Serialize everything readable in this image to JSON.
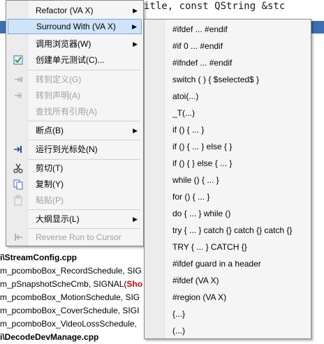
{
  "editor": {
    "code_top": "itle,   const QString &stc",
    "bottom_lines": [
      {
        "text": "i\\StreamConfig.cpp",
        "bold": true,
        "red": ""
      },
      {
        "text": "m_pcomboBox_RecordSchedule, SIG",
        "bold": false,
        "red": ""
      },
      {
        "text": "m_pSnapshotScheCmb, SIGNAL(",
        "bold": false,
        "red": "Sho"
      },
      {
        "text": "m_pcomboBox_MotionSchedule, SIG",
        "bold": false,
        "red": ""
      },
      {
        "text": "m_pcomboBox_CoverSchedule, SIGI",
        "bold": false,
        "red": ""
      },
      {
        "text": "m_pcomboBox_VideoLossSchedule,",
        "bold": false,
        "red": ""
      },
      {
        "text": "i\\DecodeDevManage.cpp",
        "bold": true,
        "red": ""
      }
    ]
  },
  "context_menu": {
    "items": [
      {
        "label": "Refactor (VA X)",
        "submenu": true,
        "disabled": false,
        "icon": ""
      },
      {
        "label": "Surround With (VA X)",
        "submenu": true,
        "disabled": false,
        "highlight": true,
        "icon": ""
      },
      {
        "label": "调用浏览器(W)",
        "submenu": true,
        "disabled": false,
        "icon": ""
      },
      {
        "label": "创建单元测试(C)...",
        "submenu": false,
        "disabled": false,
        "icon": "unit-test-icon"
      },
      {
        "label": "转到定义(G)",
        "submenu": false,
        "disabled": true,
        "icon": "goto-definition-icon"
      },
      {
        "label": "转到声明(A)",
        "submenu": false,
        "disabled": true,
        "icon": "goto-declaration-icon"
      },
      {
        "label": "查找所有引用(A)",
        "submenu": false,
        "disabled": true,
        "icon": ""
      },
      {
        "label": "断点(B)",
        "submenu": true,
        "disabled": false,
        "icon": ""
      },
      {
        "label": "运行到光标处(N)",
        "submenu": false,
        "disabled": false,
        "icon": "run-to-cursor-icon"
      },
      {
        "label": "剪切(T)",
        "submenu": false,
        "disabled": false,
        "icon": "cut-icon"
      },
      {
        "label": "复制(Y)",
        "submenu": false,
        "disabled": false,
        "icon": "copy-icon"
      },
      {
        "label": "粘贴(P)",
        "submenu": false,
        "disabled": true,
        "icon": "paste-icon"
      },
      {
        "label": "大纲显示(L)",
        "submenu": true,
        "disabled": false,
        "icon": ""
      },
      {
        "label": "Reverse Run to Cursor",
        "submenu": false,
        "disabled": true,
        "icon": "reverse-run-icon"
      }
    ]
  },
  "surround_submenu": {
    "items": [
      "#ifdef ... #endif",
      "#if 0 ... #endif",
      "#ifndef ... #endif",
      "switch ( ) { $selected$ }",
      "atoi(...)",
      "_T(...)",
      "if () { ... }",
      "if () { ... } else { }",
      "if () { } else { ... }",
      "while () { ... }",
      "for () { ... }",
      "do { ... } while ()",
      "try { ... } catch {} catch {} catch {}",
      "TRY { ... } CATCH {}",
      "#ifdef guard in a header",
      "#ifdef (VA X)",
      "#region (VA X)",
      "{...}",
      "(...)"
    ]
  },
  "colors": {
    "menu_bg": "#f5f5f5",
    "highlight_bg": "#cfe3f9",
    "highlight_border": "#7aa7e0",
    "disabled_text": "#a0a0a0",
    "selection_line": "#3c6fb1",
    "code_red": "#cc0000"
  }
}
